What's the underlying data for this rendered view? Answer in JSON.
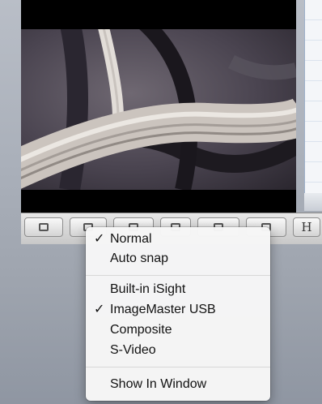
{
  "toolbar": {
    "right_button_label": "H"
  },
  "menu": {
    "checkmark": "✓",
    "groups": [
      [
        {
          "label": "Normal",
          "checked": true
        },
        {
          "label": "Auto snap",
          "checked": false
        }
      ],
      [
        {
          "label": "Built-in iSight",
          "checked": false
        },
        {
          "label": "ImageMaster USB",
          "checked": true
        },
        {
          "label": "Composite",
          "checked": false
        },
        {
          "label": "S-Video",
          "checked": false
        }
      ],
      [
        {
          "label": "Show In Window",
          "checked": false
        }
      ]
    ]
  }
}
